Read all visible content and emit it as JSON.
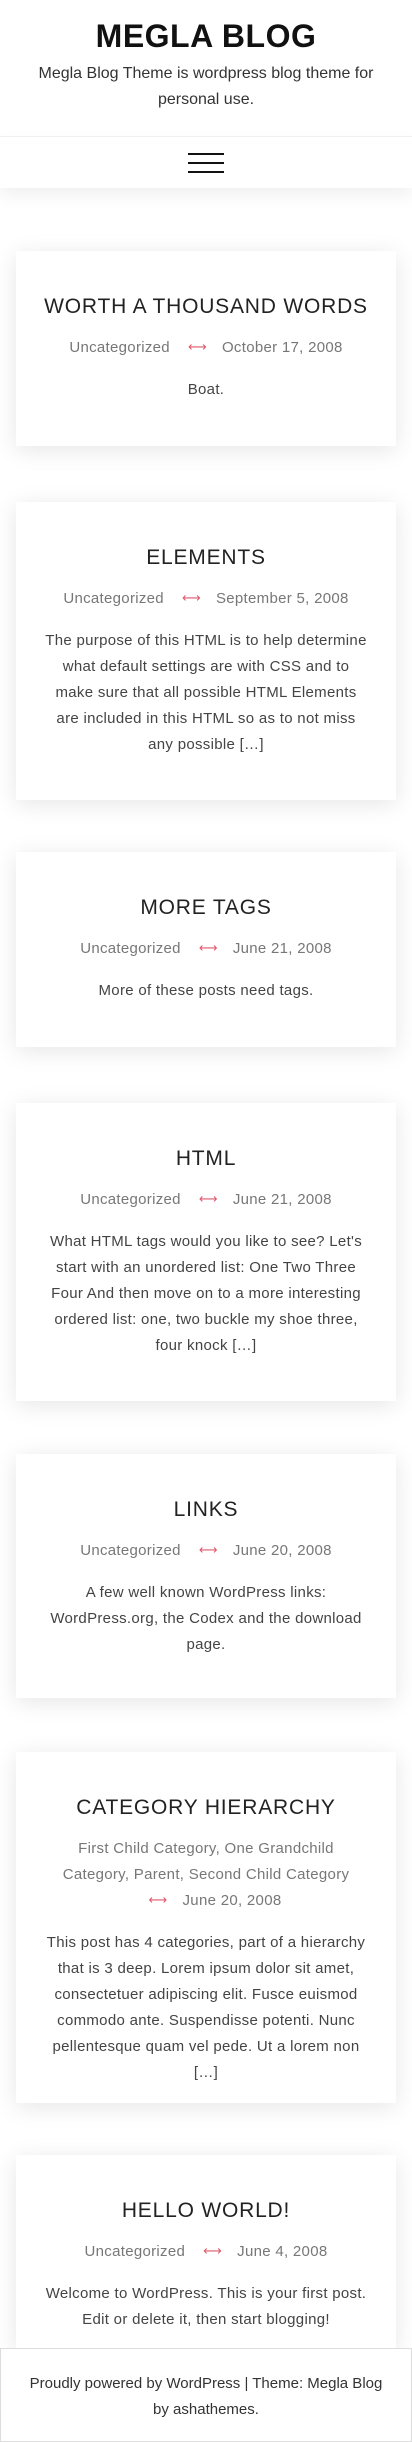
{
  "header": {
    "site_title": "MEGLA BLOG",
    "site_description": "Megla Blog Theme is wordpress blog theme for personal use."
  },
  "nav": {
    "menu_icon": "hamburger-menu-icon"
  },
  "posts": [
    {
      "title": "WORTH A THOUSAND WORDS",
      "category": "Uncategorized",
      "date": "October 17, 2008",
      "excerpt": "Boat."
    },
    {
      "title": "ELEMENTS",
      "category": "Uncategorized",
      "date": "September 5, 2008",
      "excerpt": "The purpose of this HTML is to help determine what default settings are with CSS and to make sure that all possible HTML Elements are included in this HTML so as to not miss any possible […]"
    },
    {
      "title": "MORE TAGS",
      "category": "Uncategorized",
      "date": "June 21, 2008",
      "excerpt": "More of these posts need tags."
    },
    {
      "title": "HTML",
      "category": "Uncategorized",
      "date": "June 21, 2008",
      "excerpt": "What HTML tags would you like to see? Let's start with an unordered list: One Two Three Four And then move on to a more interesting ordered list: one, two buckle my shoe three, four knock […]"
    },
    {
      "title": "LINKS",
      "category": "Uncategorized",
      "date": "June 20, 2008",
      "excerpt": "A few well known WordPress links: WordPress.org, the Codex and the download page."
    },
    {
      "title": "CATEGORY HIERARCHY",
      "categories": [
        "First Child Category",
        "One Grandchild Category",
        "Parent",
        "Second Child Category"
      ],
      "date": "June 20, 2008",
      "excerpt": "This post has 4 categories, part of a hierarchy that is 3 deep. Lorem ipsum dolor sit amet, consectetuer adipiscing elit. Fusce euismod commodo ante. Suspendisse potenti. Nunc pellentesque quam vel pede. Ut a lorem non […]"
    },
    {
      "title": "HELLO WORLD!",
      "category": "Uncategorized",
      "date": "June 4, 2008",
      "excerpt": "Welcome to WordPress. This is your first post. Edit or delete it, then start blogging!"
    }
  ],
  "footer": {
    "text": "Proudly powered by WordPress | Theme: Megla Blog by ashathemes."
  },
  "colors": {
    "separator": "#e05a6d",
    "title": "#222222",
    "meta": "#777777"
  }
}
